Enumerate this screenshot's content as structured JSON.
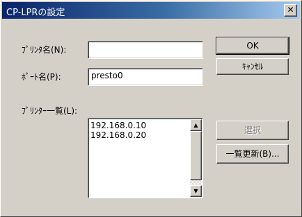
{
  "window": {
    "title": "CP-LPRの設定",
    "close_glyph": "✕"
  },
  "fields": {
    "printer_name": {
      "label": "ﾌﾟﾘﾝﾀ名(N):",
      "value": ""
    },
    "port_name": {
      "label": "ﾎﾟｰﾄ名(P):",
      "value": "presto0"
    }
  },
  "printer_list": {
    "label": "ﾌﾟﾘﾝﾀｰ一覧(L):",
    "items": [
      "192.168.0.10",
      "192.168.0.20"
    ],
    "scroll_up_glyph": "▲",
    "scroll_down_glyph": "▼"
  },
  "buttons": {
    "ok": "OK",
    "cancel": "ｷｬﾝｾﾙ",
    "select": "選択",
    "refresh": "一覧更新(B)..."
  }
}
